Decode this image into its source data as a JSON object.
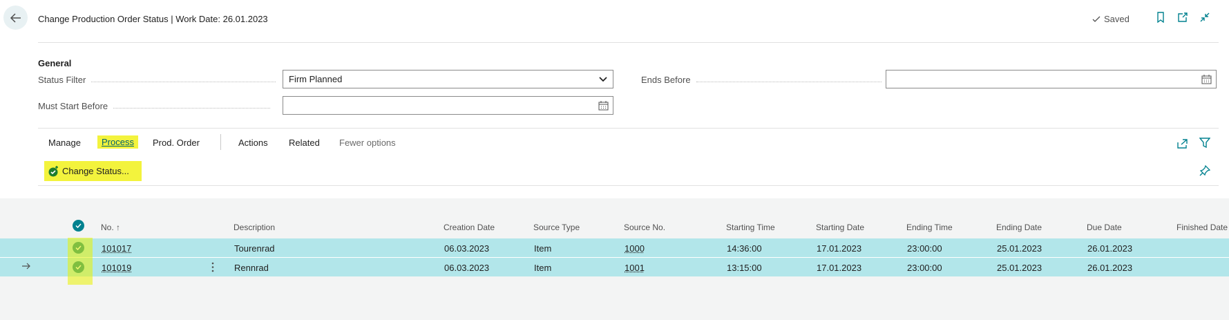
{
  "header": {
    "title": "Change Production Order Status | Work Date: 26.01.2023",
    "saved_label": "Saved"
  },
  "general": {
    "section_title": "General",
    "status_filter_label": "Status Filter",
    "status_filter_value": "Firm Planned",
    "must_start_before_label": "Must Start Before",
    "must_start_before_value": "",
    "ends_before_label": "Ends Before",
    "ends_before_value": ""
  },
  "actionbar": {
    "tabs": [
      "Manage",
      "Process",
      "Prod. Order",
      "Actions",
      "Related",
      "Fewer options"
    ],
    "active_tab": "Process",
    "change_status_label": "Change Status..."
  },
  "table": {
    "columns": [
      "No. ↑",
      "Description",
      "Creation Date",
      "Source Type",
      "Source No.",
      "Starting Time",
      "Starting Date",
      "Ending Time",
      "Ending Date",
      "Due Date",
      "Finished Date"
    ],
    "rows": [
      {
        "no": "101017",
        "description": "Tourenrad",
        "creation_date": "06.03.2023",
        "source_type": "Item",
        "source_no": "1000",
        "starting_time": "14:36:00",
        "starting_date": "17.01.2023",
        "ending_time": "23:00:00",
        "ending_date": "25.01.2023",
        "due_date": "26.01.2023",
        "finished_date": ""
      },
      {
        "no": "101019",
        "description": "Rennrad",
        "creation_date": "06.03.2023",
        "source_type": "Item",
        "source_no": "1001",
        "starting_time": "13:15:00",
        "starting_date": "17.01.2023",
        "ending_time": "23:00:00",
        "ending_date": "25.01.2023",
        "due_date": "26.01.2023",
        "finished_date": ""
      }
    ]
  },
  "colors": {
    "accent": "#00818f",
    "highlight": "#f3f33d",
    "row_selected": "#b2e6ea"
  },
  "icons": [
    "back-arrow-icon",
    "checkmark-icon",
    "bookmark-icon",
    "open-in-new-window-icon",
    "collapse-icon",
    "dropdown-chevron-icon",
    "calendar-icon",
    "share-icon",
    "filter-icon",
    "pin-icon",
    "change-status-icon",
    "row-arrow-icon",
    "more-options-icon"
  ]
}
